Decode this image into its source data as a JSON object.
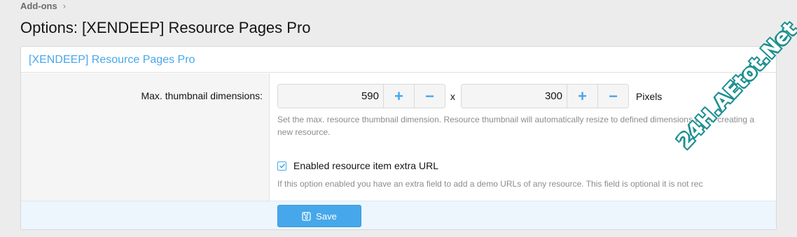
{
  "breadcrumb": {
    "item": "Add-ons",
    "separator": "›"
  },
  "page": {
    "title": "Options: [XENDEEP] Resource Pages Pro"
  },
  "block": {
    "header": "[XENDEEP] Resource Pages Pro",
    "thumbnail": {
      "label": "Max. thumbnail dimensions:",
      "width_value": "590",
      "height_value": "300",
      "separator": "x",
      "unit": "Pixels",
      "plus": "+",
      "minus": "−",
      "hint": "Set the max. resource thumbnail dimension. Resource thumbnail will automatically resize to defined dimensions when creating a new resource."
    },
    "extra_url": {
      "checked": true,
      "label": "Enabled resource item extra URL",
      "hint": "If this option enabled you have an extra field to add a demo URLs of any resource. This field is optional it is not rec"
    },
    "save_label": "Save"
  },
  "watermark": {
    "text": "24H.AEtot.Net"
  },
  "colors": {
    "accent": "#47a7eb",
    "header_link": "#47a7eb",
    "footer_bg": "#edf6fd",
    "watermark_outline": "#1d8f91"
  },
  "icons": {
    "breadcrumb": "chevron-right-icon",
    "checkbox": "check-icon",
    "save": "floppy-disk-icon"
  }
}
